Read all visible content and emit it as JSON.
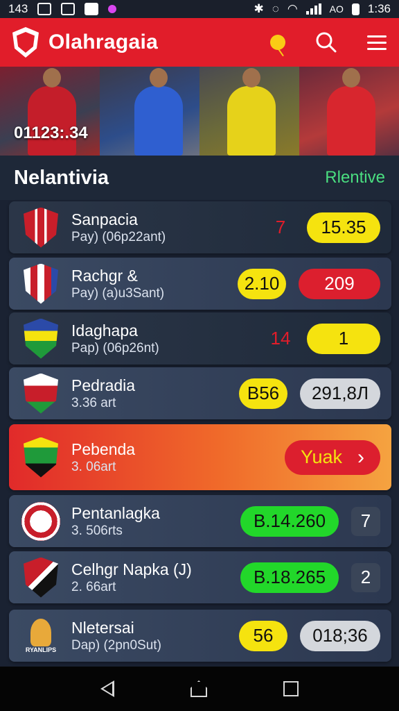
{
  "status": {
    "left_number": "143",
    "right_text": "AO",
    "time": "1:36"
  },
  "appbar": {
    "title": "Olahragaia"
  },
  "banner": {
    "score": "01123:.34"
  },
  "section": {
    "title": "Nelantivia",
    "link": "Rlentive"
  },
  "colors": {
    "accent_red": "#e11d2a",
    "pill_yellow": "#f5e30f",
    "pill_green": "#22d72a",
    "link_green": "#4ade80"
  },
  "rows": [
    {
      "name": "Sanpacia",
      "sub": "Pay) (06p22ant)",
      "left": "7",
      "right": "15.35"
    },
    {
      "name": "Rachgr &",
      "sub": "Pay) (a)u3Sant)",
      "left": "2.10",
      "right": "209"
    },
    {
      "name": "Idaghapa",
      "sub": "Pap) (06p26nt)",
      "left": "14",
      "right": "1"
    },
    {
      "name": "Pedradia",
      "sub": "3.36 art",
      "left": "B56",
      "right": "291,8Л"
    },
    {
      "name": "Pebenda",
      "sub": "3. 06art",
      "cta": "Yuak"
    },
    {
      "name": "Pentanlagka",
      "sub": "3. 506rts",
      "left": "B.14.260",
      "right": "7"
    },
    {
      "name": "Celhgr Napka (J)",
      "sub": "2. 66art",
      "left": "B.18.265",
      "right": "2"
    },
    {
      "name": "Nletersai",
      "sub": "Dap) (2pn0Sut)",
      "left": "56",
      "right": "018;36",
      "crest_text": "RYANLIPS"
    }
  ]
}
